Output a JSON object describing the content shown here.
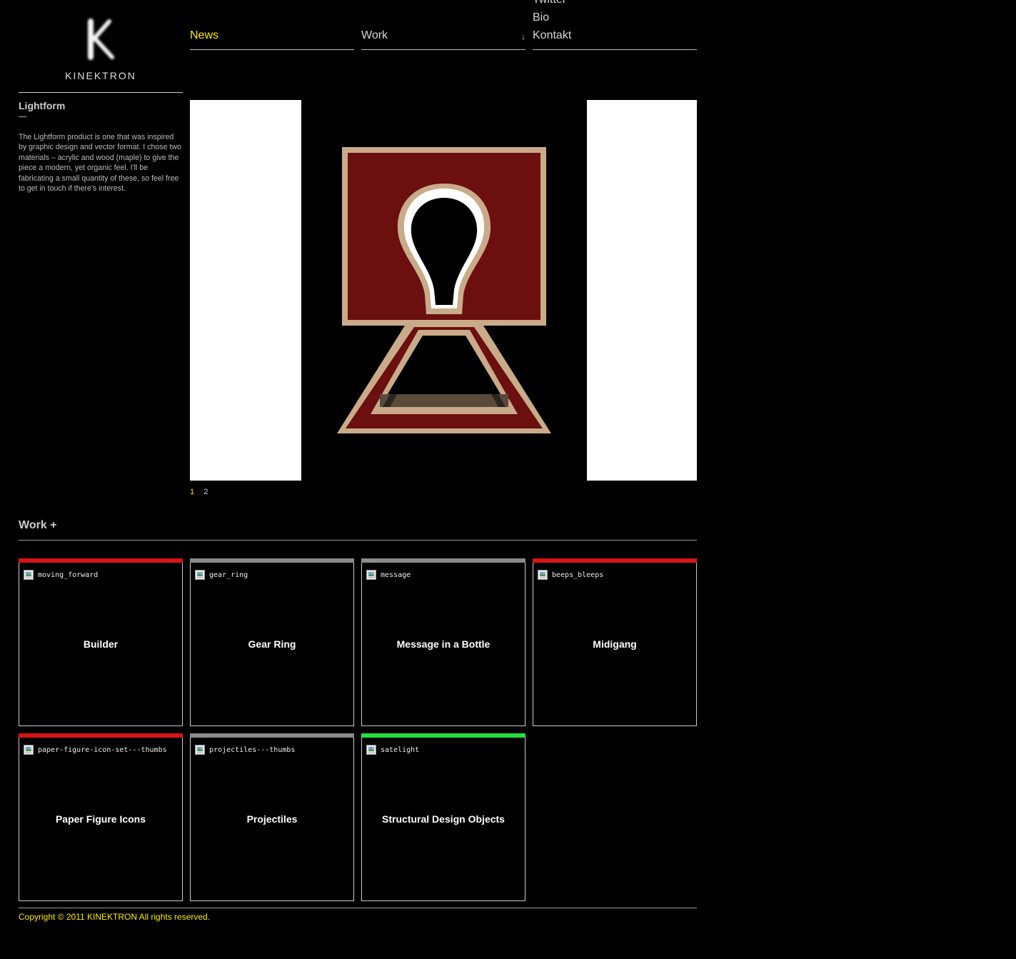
{
  "logo": {
    "letter": "K",
    "text": "KINEKTRON"
  },
  "nav": {
    "news": "News",
    "work": "Work",
    "work_arrow": "↓",
    "twitter": "Twitter",
    "bio": "Bio",
    "kontakt": "Kontakt"
  },
  "project": {
    "title": "Lightform",
    "description": "The Lightform product is one that was inspired by graphic design and vector format.  I chose two materials – acrylic and wood (maple) to give the piece a modern, yet organic feel.  I'll be fabricating a small quantity of these, so feel free to get in touch if there's interest."
  },
  "pager": {
    "pages": [
      "1",
      "2"
    ],
    "active": "1"
  },
  "work": {
    "heading": "Work +",
    "tiles": [
      {
        "alt": "moving_forward",
        "title": "Builder",
        "bar_color": "#d81414"
      },
      {
        "alt": "gear_ring",
        "title": "Gear Ring",
        "bar_color": "#8a8a8a"
      },
      {
        "alt": "message",
        "title": "Message in a Bottle",
        "bar_color": "#8a8a8a"
      },
      {
        "alt": "beeps_bleeps",
        "title": "Midigang",
        "bar_color": "#d81414"
      },
      {
        "alt": "paper-figure-icon-set---thumbs",
        "title": "Paper Figure Icons",
        "bar_color": "#d81414"
      },
      {
        "alt": "projectiles---thumbs",
        "title": "Projectiles",
        "bar_color": "#8a8a8a"
      },
      {
        "alt": "satelight",
        "title": "Structural Design Objects",
        "bar_color": "#22e03c"
      }
    ]
  },
  "footer": {
    "copyright": "Copyright © 2011 KINEKTRON All rights reserved."
  },
  "colors": {
    "accent": "#ffe900",
    "background": "#000000"
  }
}
